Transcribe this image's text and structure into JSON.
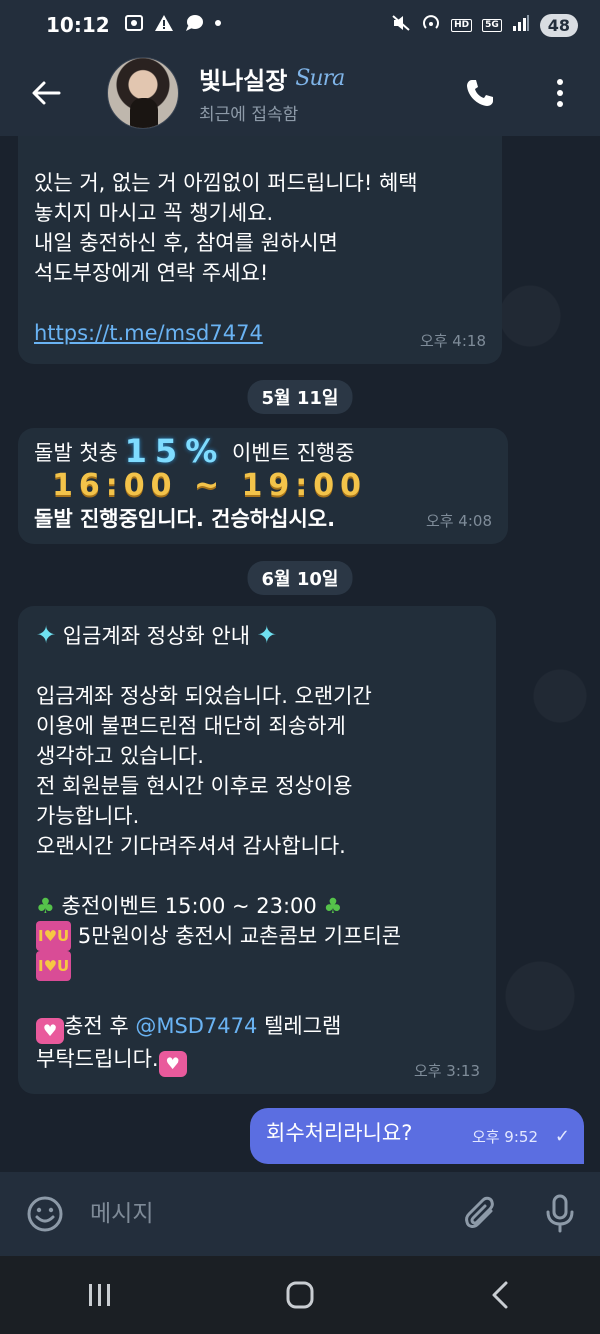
{
  "status_bar": {
    "time": "10:12",
    "left_icons": [
      "screenshot-icon",
      "warning-icon",
      "chat-icon",
      "dot-icon"
    ],
    "right_icons": [
      "mute-icon",
      "hotspot-icon",
      "hd-voice-icon",
      "5g-icon",
      "signal-icon"
    ],
    "hd_label": "HD",
    "network_label": "5G",
    "battery": "48"
  },
  "header": {
    "title": "빛나실장",
    "logo_text": "Sura",
    "subtitle": "최근에 접속함"
  },
  "messages": [
    {
      "lines": [
        "있는 거, 없는 거 아낌없이 퍼드립니다! 혜택",
        "놓치지 마시고 꼭 챙기세요.",
        "내일 충전하신 후, 참여를 원하시면",
        "석도부장에게 연락 주세요!"
      ],
      "link": "https://t.me/msd7474",
      "time": "오후 4:18"
    },
    {
      "date": "5월 11일",
      "line1_prefix": "돌발 첫충",
      "line1_big": "15%",
      "line1_suffix": "이벤트 진행중",
      "line2": "16:00 ~ 19:00",
      "line3": "돌발 진행중입니다. 건승하십시오.",
      "time": "오후 4:08"
    },
    {
      "date": "6월 10일",
      "title": "입금계좌 정상화 안내",
      "body": [
        "입금계좌 정상화 되었습니다. 오랜기간",
        "이용에 불편드린점 대단히 죄송하게",
        "생각하고 있습니다.",
        "전 회원분들 현시간 이후로 정상이용",
        "가능합니다.",
        "오랜시간 기다려주셔셔 감사합니다."
      ],
      "event_line": "충전이벤트 15:00 ~ 23:00",
      "gift_line": "5만원이상 충전시 교촌콤보 기프티콘",
      "closing_prefix": "충전 후",
      "mention": "@MSD7474",
      "closing_suffix": "텔레그램",
      "closing_line2": "부탁드립니다.",
      "time": "오후 3:13"
    },
    {
      "outgoing": true,
      "text": "회수처리라니요?",
      "time": "오후 9:52"
    }
  ],
  "composer": {
    "placeholder": "메시지"
  },
  "colors": {
    "background": "#1a222d",
    "header": "#232e3c",
    "incoming_bubble": "#222e3a",
    "outgoing_bubble": "#5b6ee1",
    "link": "#6ab3f3"
  }
}
